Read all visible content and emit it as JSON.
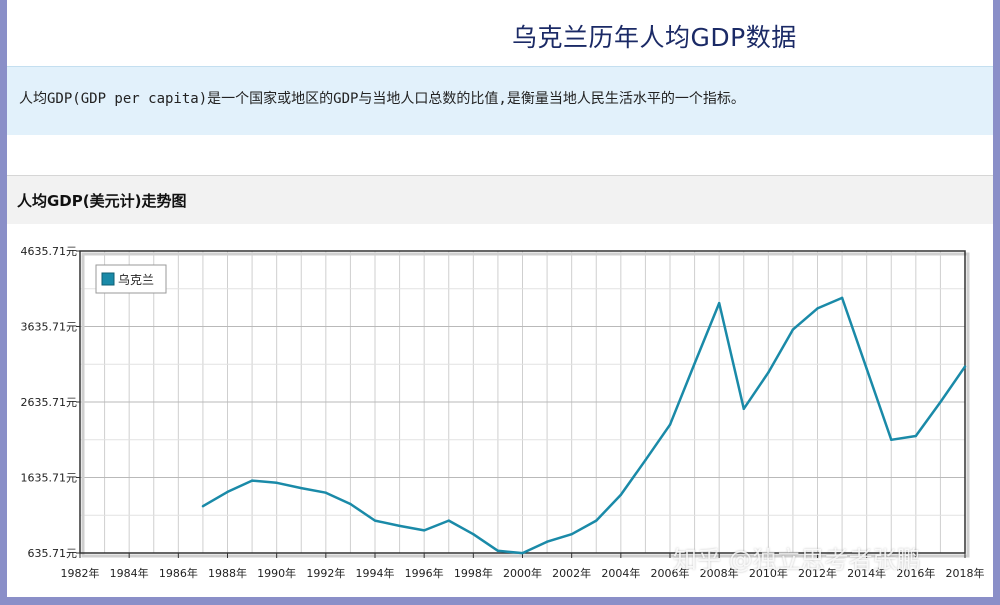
{
  "page": {
    "title": "乌克兰历年人均GDP数据",
    "description": "人均GDP(GDP per capita)是一个国家或地区的GDP与当地人口总数的比值,是衡量当地人民生活水平的一个指标。",
    "section_title": "人均GDP(美元计)走势图",
    "watermark": "知乎 @独立思考者张鹏"
  },
  "chart_data": {
    "type": "line",
    "title": "",
    "xlabel": "",
    "ylabel": "",
    "xlim": [
      1982,
      2018
    ],
    "ylim": [
      635.71,
      4635.71
    ],
    "x_ticks": [
      "1982年",
      "1984年",
      "1986年",
      "1988年",
      "1990年",
      "1992年",
      "1994年",
      "1996年",
      "1998年",
      "2000年",
      "2002年",
      "2004年",
      "2006年",
      "2008年",
      "2010年",
      "2012年",
      "2014年",
      "2016年",
      "2018年"
    ],
    "y_ticks": [
      "635.71元",
      "1635.71元",
      "2635.71元",
      "3635.71元",
      "4635.71元"
    ],
    "y_tick_values": [
      635.71,
      1635.71,
      2635.71,
      3635.71,
      4635.71
    ],
    "grid": true,
    "legend_position": "top-left",
    "colors": {
      "series": "#1a8aa8",
      "grid": "#cfcfcf"
    },
    "series": [
      {
        "name": "乌克兰",
        "x": [
          1987,
          1988,
          1989,
          1990,
          1991,
          1992,
          1993,
          1994,
          1995,
          1996,
          1997,
          1998,
          1999,
          2000,
          2001,
          2002,
          2003,
          2004,
          2005,
          2006,
          2007,
          2008,
          2009,
          2010,
          2011,
          2012,
          2013,
          2014,
          2015,
          2016,
          2017,
          2018
        ],
        "values": [
          1255,
          1445,
          1595,
          1565,
          1495,
          1435,
          1285,
          1065,
          995,
          935,
          1065,
          885,
          665,
          635,
          785,
          885,
          1065,
          1405,
          1865,
          2335,
          3145,
          3945,
          2545,
          3025,
          3595,
          3875,
          4015,
          3075,
          2135,
          2185,
          2635,
          3105
        ]
      }
    ]
  }
}
